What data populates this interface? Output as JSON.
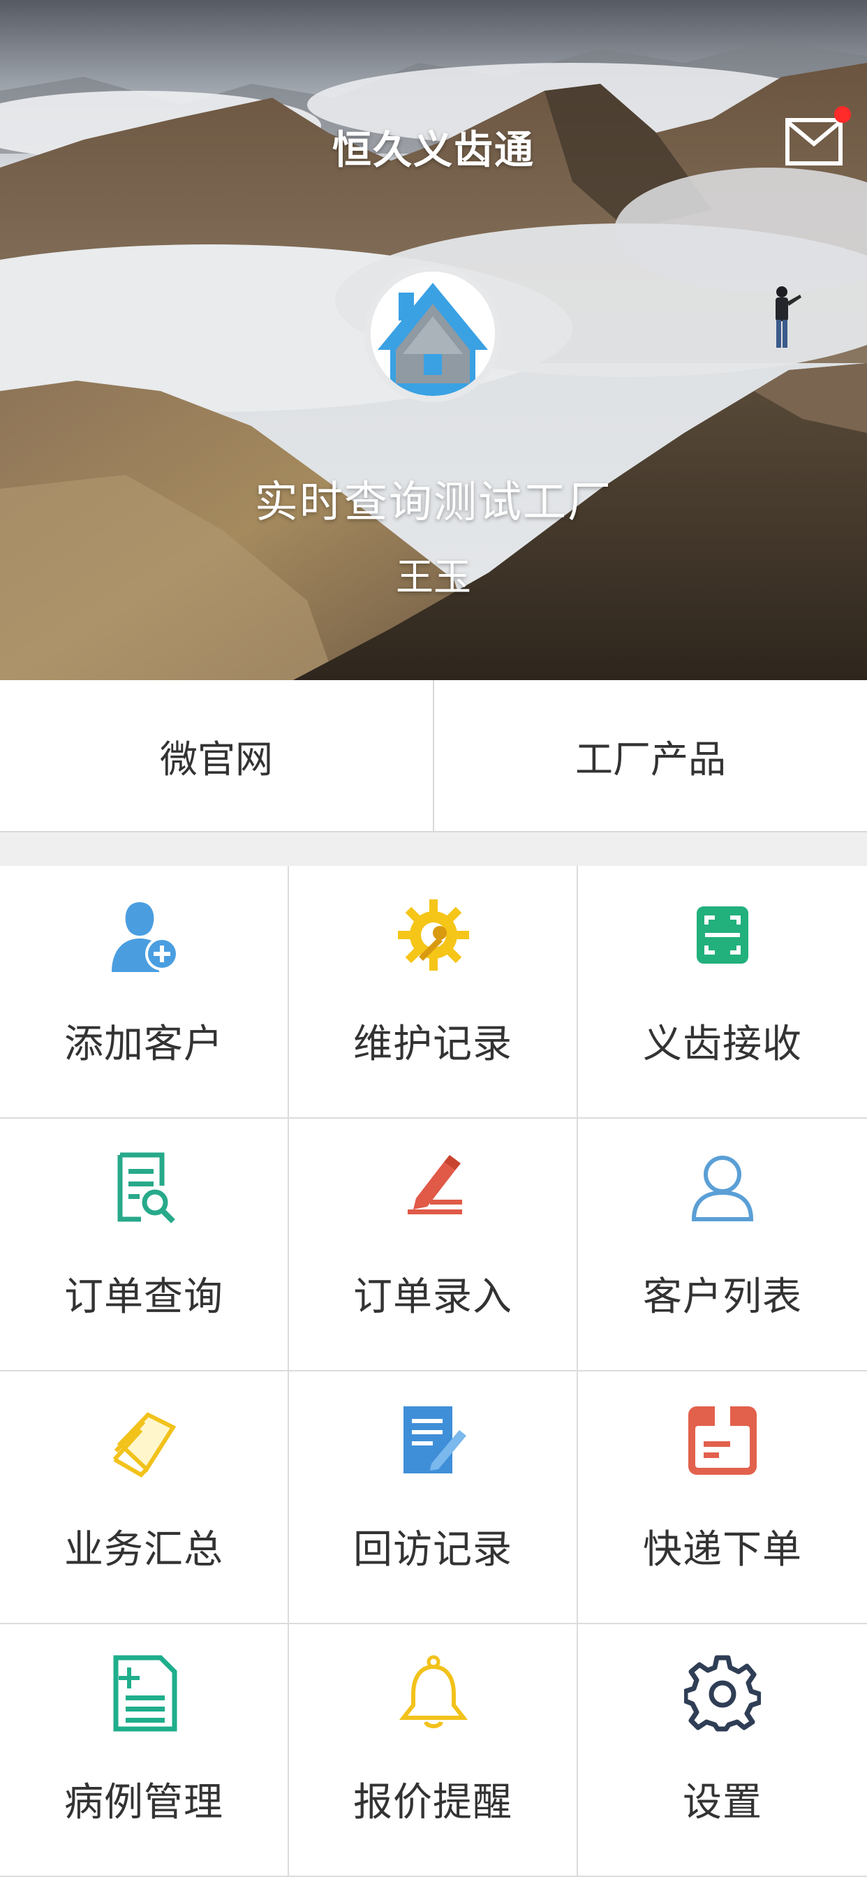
{
  "header": {
    "app_title": "恒久义齿通",
    "factory_name": "实时查询测试工厂",
    "user_name": "王玉",
    "mail_icon": "mail-icon",
    "has_unread": true,
    "avatar_icon": "house-icon"
  },
  "links": [
    {
      "label": "微官网"
    },
    {
      "label": "工厂产品"
    }
  ],
  "menu": [
    {
      "label": "添加客户",
      "icon": "add-user-icon",
      "color": "#4a9ee0"
    },
    {
      "label": "维护记录",
      "icon": "gear-wrench-icon",
      "color": "#f5c518"
    },
    {
      "label": "义齿接收",
      "icon": "scan-icon",
      "color": "#22b07d"
    },
    {
      "label": "订单查询",
      "icon": "document-search-icon",
      "color": "#27a98a"
    },
    {
      "label": "订单录入",
      "icon": "pencil-entry-icon",
      "color": "#e05a47"
    },
    {
      "label": "客户列表",
      "icon": "user-icon",
      "color": "#5a9fd6"
    },
    {
      "label": "业务汇总",
      "icon": "stack-papers-icon",
      "color": "#f2c21b"
    },
    {
      "label": "回访记录",
      "icon": "notepad-pen-icon",
      "color": "#3f8fd8"
    },
    {
      "label": "快递下单",
      "icon": "package-icon",
      "color": "#e2614c"
    },
    {
      "label": "病例管理",
      "icon": "clipboard-plus-icon",
      "color": "#1fae8c"
    },
    {
      "label": "报价提醒",
      "icon": "bell-icon",
      "color": "#f2c21b"
    },
    {
      "label": "设置",
      "icon": "settings-icon",
      "color": "#2f3e55"
    }
  ]
}
